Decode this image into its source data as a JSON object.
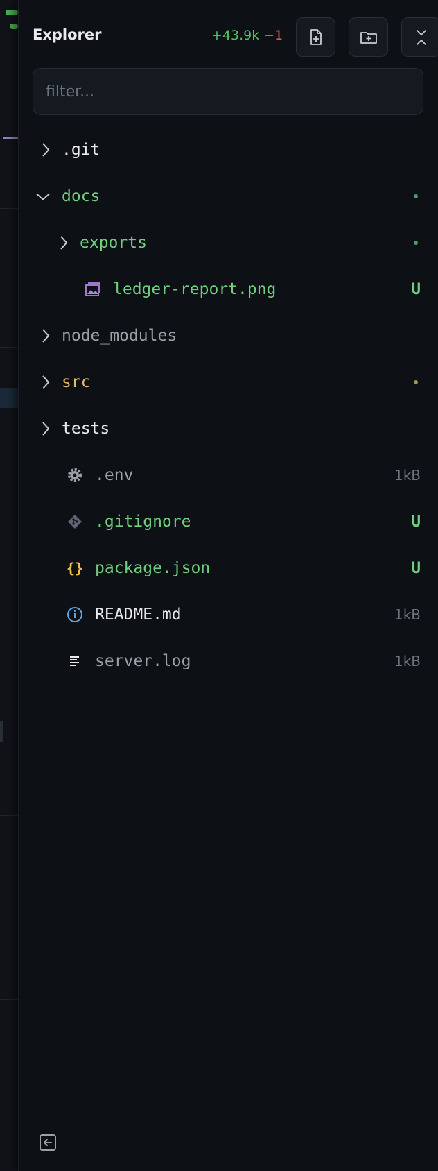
{
  "explorer": {
    "title": "Explorer",
    "diff_added": "+43.9k",
    "diff_removed": "−1",
    "filter_placeholder": "filter..."
  },
  "tree": [
    {
      "name": ".git",
      "kind": "folder",
      "expanded": false,
      "color": "#e8eaed"
    },
    {
      "name": "docs",
      "kind": "folder",
      "expanded": true,
      "color": "#6fcf7f",
      "dot": "#4f9c63"
    },
    {
      "name": "exports",
      "kind": "folder",
      "expanded": false,
      "color": "#6fcf7f",
      "dot": "#4f9c63"
    },
    {
      "name": "ledger-report.png",
      "kind": "image",
      "color": "#6fcf7f",
      "badge": "U"
    },
    {
      "name": "node_modules",
      "kind": "folder",
      "expanded": false,
      "color": "#9aa0a6"
    },
    {
      "name": "src",
      "kind": "folder",
      "expanded": false,
      "color": "#e6b96a",
      "dot": "#a8905c"
    },
    {
      "name": "tests",
      "kind": "folder",
      "expanded": false,
      "color": "#e8eaed"
    },
    {
      "name": ".env",
      "kind": "settings",
      "color": "#9aa0a6",
      "size": "1kB"
    },
    {
      "name": ".gitignore",
      "kind": "git",
      "color": "#6fcf7f",
      "badge": "U"
    },
    {
      "name": "package.json",
      "kind": "json",
      "color": "#6fcf7f",
      "badge": "U"
    },
    {
      "name": "README.md",
      "kind": "info",
      "color": "#e8eaed",
      "size": "1kB"
    },
    {
      "name": "server.log",
      "kind": "log",
      "color": "#9aa0a6",
      "size": "1kB"
    }
  ],
  "colors": {
    "added": "#4ec25c",
    "removed": "#f0544f",
    "untracked_badge": "#6fcf7f"
  }
}
